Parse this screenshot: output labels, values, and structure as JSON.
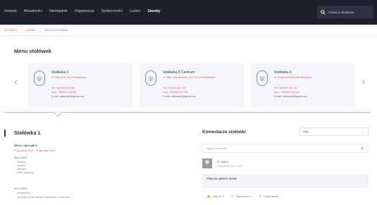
{
  "nav": {
    "items": [
      "Intranet",
      "Aktualności",
      "Niezbędnik",
      "Organizacja",
      "Społeczności",
      "Ludzie",
      "Zasoby"
    ],
    "active_index": 6,
    "search_placeholder": "Szukaj w intranecie"
  },
  "breadcrumb": [
    "INTRANET",
    "ZASOBY",
    "MENU STOŁÓWEK"
  ],
  "menu_section": {
    "title": "Menu stołówek",
    "canteens": [
      {
        "name": "Stołówka 1",
        "address": "ul. Złota 36 D 34-339 Warszawa",
        "tel": "Tel: +48 608 208 268",
        "kom": "Kom: +48 608 208 268",
        "email": "E-mail: stolowka1@gmail.com"
      },
      {
        "name": "Stołówka 2 Centrum",
        "address": "ul. Aleje Jerozolimskie 145 D 34-133 Warszawa",
        "tel": "Tel: +48 663 402 700",
        "kom": "Kom: +48 663 402 700",
        "email": "E-mail: stolowka2@gmail.com"
      },
      {
        "name": "Stołówka 3",
        "address": "ul. Grójecka 55 B2 168 Warszawa",
        "tel": "Tel: +48 600 100 122",
        "kom": "Kom: +48 600 100 122",
        "email": "E-mail: stolowka3@gmail.com"
      }
    ]
  },
  "canteen_detail": {
    "title": "Stołówka 1",
    "menu_label": "Menu specjalne",
    "menu_dates": "22 grudnia 2016 - 30 grudnia 2016",
    "days": [
      {
        "date": "05.12.2016",
        "dishes": [
          "- kanapka",
          "- bezgam",
          "- warzywa",
          "- kotlet schabowy"
        ]
      },
      {
        "date": "06.12.2016",
        "dishes": [
          "- pomidorowa",
          "- ziemniaki, kotlet mielony, marchewka z groszkiem"
        ]
      }
    ]
  },
  "comments": {
    "title": "Komentarze stołówki",
    "sort_value": "Data",
    "input_placeholder": "Napisz komentarz",
    "items": [
      {
        "author": "PL GALS",
        "time": "20 kwietnia 2017 12:23",
        "text": "Polecam główne danie!",
        "like_label": "Lubię to",
        "like_count": "0",
        "reply_label": "Odpowiedz",
        "reply_count": "0",
        "more_label": "Czytaj więcej"
      }
    ]
  },
  "colors": {
    "nav_bg": "#1c1f2c",
    "accent": "#e05a5a",
    "icon_blue": "#6b8fd6",
    "card_bg": "#f4f6fb"
  }
}
